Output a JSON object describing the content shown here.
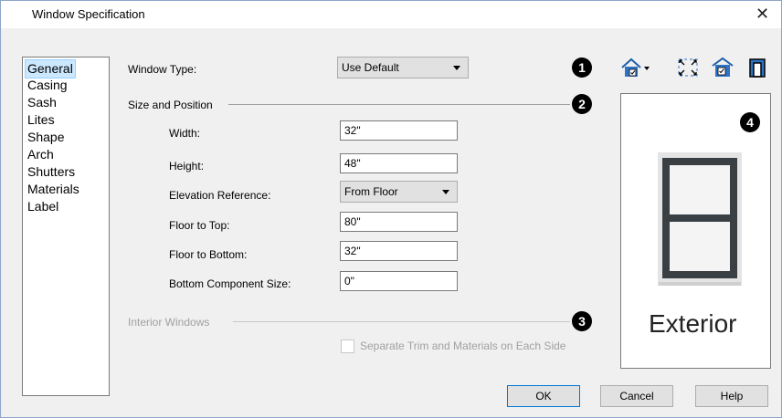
{
  "window": {
    "title": "Window Specification"
  },
  "sidebar": {
    "items": [
      "General",
      "Casing",
      "Sash",
      "Lites",
      "Shape",
      "Arch",
      "Shutters",
      "Materials",
      "Label"
    ],
    "selected": "General"
  },
  "general": {
    "window_type_label": "Window Type:",
    "window_type_value": "Use Default",
    "size_position_label": "Size and Position",
    "width_label": "Width:",
    "width_value": "32\"",
    "height_label": "Height:",
    "height_value": "48\"",
    "elev_ref_label": "Elevation Reference:",
    "elev_ref_value": "From Floor",
    "floor_top_label": "Floor to Top:",
    "floor_top_value": "80\"",
    "floor_bottom_label": "Floor to Bottom:",
    "floor_bottom_value": "32\"",
    "bottom_comp_label": "Bottom Component Size:",
    "bottom_comp_value": "0\"",
    "interior_windows_label": "Interior Windows",
    "separate_trim_label": "Separate Trim and Materials on Each Side",
    "separate_trim_checked": false
  },
  "badges": [
    "1",
    "2",
    "3",
    "4"
  ],
  "preview": {
    "label": "Exterior"
  },
  "toolbar_icons": [
    "house-view-dropdown-icon",
    "fill-window-icon",
    "door-window-icon",
    "opening-icon"
  ],
  "buttons": {
    "ok": "OK",
    "cancel": "Cancel",
    "help": "Help"
  },
  "colors": {
    "selection": "#cce8ff",
    "dialog_border": "#8ea4c8",
    "default_button_border": "#0078d7"
  }
}
